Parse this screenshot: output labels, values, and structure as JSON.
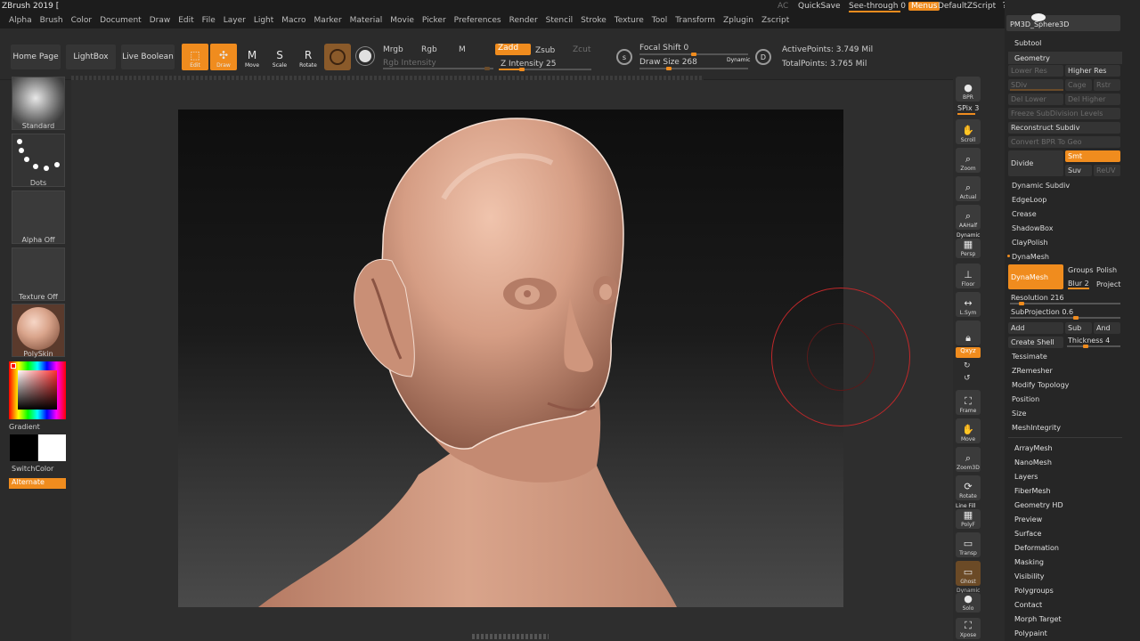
{
  "app": {
    "title": "ZBrush 2019 [",
    "ac": "AC",
    "quicksave": "QuickSave",
    "see_through": "See-through  0",
    "menus": "Menus",
    "default_zscript": "DefaultZScript",
    "tool_name": "PM3D_Sphere3D"
  },
  "menubar": [
    "Alpha",
    "Brush",
    "Color",
    "Document",
    "Draw",
    "Edit",
    "File",
    "Layer",
    "Light",
    "Macro",
    "Marker",
    "Material",
    "Movie",
    "Picker",
    "Preferences",
    "Render",
    "Stencil",
    "Stroke",
    "Texture",
    "Tool",
    "Transform",
    "Zplugin",
    "Zscript"
  ],
  "toolbar": {
    "home_page": "Home Page",
    "lightbox": "LightBox",
    "live_boolean": "Live Boolean",
    "edit": "Edit",
    "draw": "Draw",
    "move": "Move",
    "scale": "Scale",
    "rotate": "Rotate",
    "mrgb": "Mrgb",
    "rgb": "Rgb",
    "m": "M",
    "zadd": "Zadd",
    "zsub": "Zsub",
    "zcut": "Zcut",
    "rgb_intensity": "Rgb Intensity",
    "z_intensity": "Z Intensity 25",
    "focal_shift": "Focal Shift 0",
    "draw_size": "Draw Size 268",
    "dynamic": "Dynamic",
    "active_points": "ActivePoints: 3.749 Mil",
    "total_points": "TotalPoints: 3.765 Mil",
    "z_intensity_value": 25,
    "focal_shift_value": 0,
    "draw_size_value": 268
  },
  "leftshelf": {
    "brush": "Standard",
    "stroke": "Dots",
    "alpha": "Alpha Off",
    "texture": "Texture Off",
    "material": "PolySkin",
    "gradient": "Gradient",
    "switch_color": "SwitchColor",
    "alternate": "Alternate"
  },
  "rightshelf": {
    "bpr": "BPR",
    "spix": "SPix 3",
    "scroll": "Scroll",
    "zoom": "Zoom",
    "actual": "Actual",
    "aahalf": "AAHalf",
    "persp_top": "Dynamic",
    "persp": "Persp",
    "floor": "Floor",
    "lsym": "L.Sym",
    "xyz": "Qxyz",
    "frame": "Frame",
    "move": "Move",
    "zoom3d": "Zoom3D",
    "rotate": "Rotate",
    "linefill": "Line Fill",
    "polyf": "PolyF",
    "transp": "Transp",
    "ghost": "Ghost",
    "solo_top": "Dynamic",
    "solo": "Solo",
    "xpose": "Xpose"
  },
  "subtool": {
    "subtool": "Subtool",
    "geometry": "Geometry",
    "lower_res": "Lower Res",
    "higher_res": "Higher Res",
    "sdiv": "SDiv",
    "cage": "Cage",
    "rstr": "Rstr",
    "del_lower": "Del Lower",
    "del_higher": "Del Higher",
    "freeze": "Freeze SubDivision Levels",
    "reconstruct": "Reconstruct Subdiv",
    "convert_bpr": "Convert BPR To Geo",
    "divide": "Divide",
    "smt": "Smt",
    "suv": "Suv",
    "reuv": "ReUV",
    "dynamic_subdiv": "Dynamic Subdiv",
    "edgeloop": "EdgeLoop",
    "crease": "Crease",
    "shadowbox": "ShadowBox",
    "claypolish": "ClayPolish",
    "dynamesh_header": "DynaMesh",
    "dynamesh": "DynaMesh",
    "groups": "Groups",
    "polish": "Polish",
    "blur": "Blur 2",
    "project": "Project",
    "resolution": "Resolution 216",
    "subprojection": "SubProjection 0.6",
    "add": "Add",
    "sub": "Sub",
    "and": "And",
    "create_shell": "Create Shell",
    "thickness": "Thickness 4",
    "tessimate": "Tessimate",
    "zremesher": "ZRemesher",
    "modify_topology": "Modify Topology",
    "position": "Position",
    "size": "Size",
    "meshintegrity": "MeshIntegrity",
    "more": [
      "ArrayMesh",
      "NanoMesh",
      "Layers",
      "FiberMesh",
      "Geometry HD",
      "Preview",
      "Surface",
      "Deformation",
      "Masking",
      "Visibility",
      "Polygroups",
      "Contact",
      "Morph Target",
      "Polypaint"
    ]
  },
  "colors": {
    "accent": "#f08c1e",
    "panel": "#2b2b2b",
    "skin": "#d9a48b",
    "cursor": "#c0282a"
  }
}
